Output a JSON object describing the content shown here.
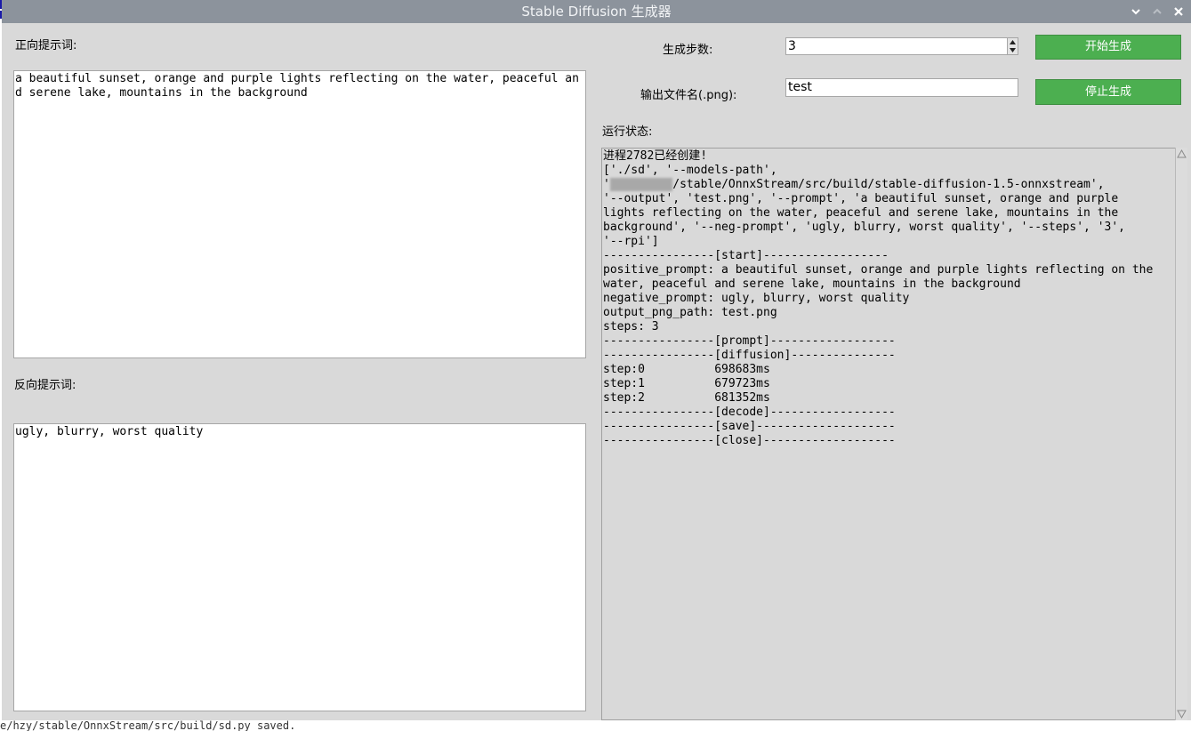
{
  "window": {
    "title": "Stable Diffusion 生成器"
  },
  "positive": {
    "label": "正向提示词:",
    "value": "a beautiful sunset, orange and purple lights reflecting on the water, peaceful and serene lake, mountains in the background"
  },
  "negative": {
    "label": "反向提示词:",
    "value": "ugly, blurry, worst quality"
  },
  "steps": {
    "label": "生成步数:",
    "value": "3"
  },
  "output": {
    "label": "输出文件名(.png):",
    "value": "test"
  },
  "buttons": {
    "start": "开始生成",
    "stop": "停止生成"
  },
  "status": {
    "label": "运行状态:",
    "lines": [
      "进程2782已经创建!",
      "['./sd', '--models-path',",
      "/stable/OnnxStream/src/build/stable-diffusion-1.5-onnxstream',",
      "'--output', 'test.png', '--prompt', 'a beautiful sunset, orange and purple",
      "lights reflecting on the water, peaceful and serene lake, mountains in the",
      "background', '--neg-prompt', 'ugly, blurry, worst quality', '--steps', '3',",
      "'--rpi']",
      "----------------[start]------------------",
      "positive_prompt: a beautiful sunset, orange and purple lights reflecting on the",
      "water, peaceful and serene lake, mountains in the background",
      "negative_prompt: ugly, blurry, worst quality",
      "output_png_path: test.png",
      "steps: 3",
      "----------------[prompt]------------------",
      "----------------[diffusion]---------------",
      "step:0          698683ms",
      "step:1          679723ms",
      "step:2          681352ms",
      "----------------[decode]------------------",
      "----------------[save]--------------------",
      "----------------[close]-------------------"
    ]
  },
  "background_terminal": {
    "text": "e/hzy/stable/OnnxStream/src/build/sd.py saved."
  },
  "icons": {
    "minimize": "chevron-down-icon",
    "maximize": "chevron-up-icon",
    "close": "close-icon"
  },
  "colors": {
    "titlebar": "#8c939c",
    "window_bg": "#d9d9d9",
    "button_green": "#4caf50"
  }
}
